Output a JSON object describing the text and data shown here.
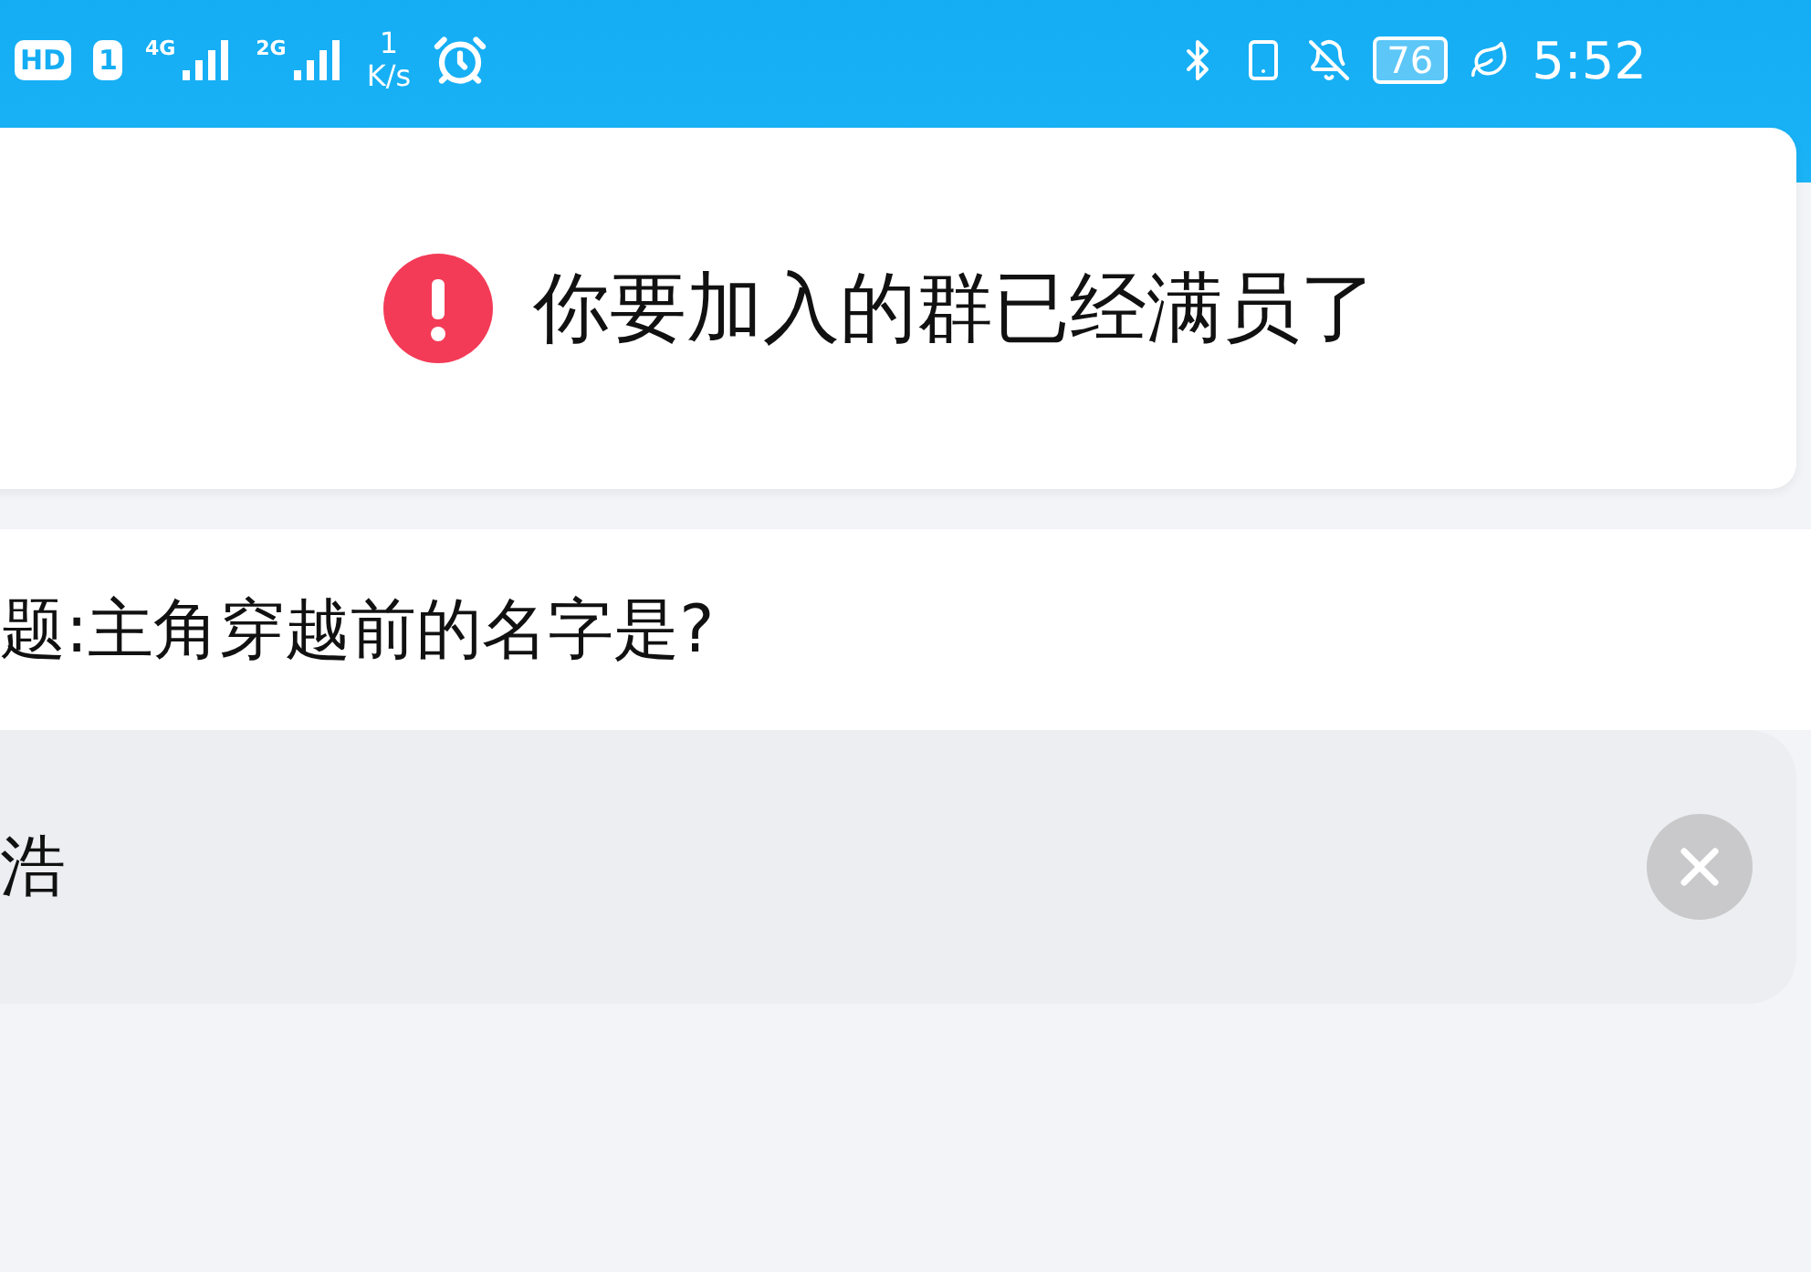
{
  "status_bar": {
    "badges": [
      "HD",
      "1"
    ],
    "networks": [
      {
        "label": "4G"
      },
      {
        "label": "2G"
      }
    ],
    "speed": {
      "value": "1",
      "unit": "K/s"
    },
    "battery": "76",
    "time": "5:52"
  },
  "alert": {
    "message": "你要加入的群已经满员了"
  },
  "question": "题:主角穿越前的名字是?",
  "answer": {
    "value": "浩"
  }
}
